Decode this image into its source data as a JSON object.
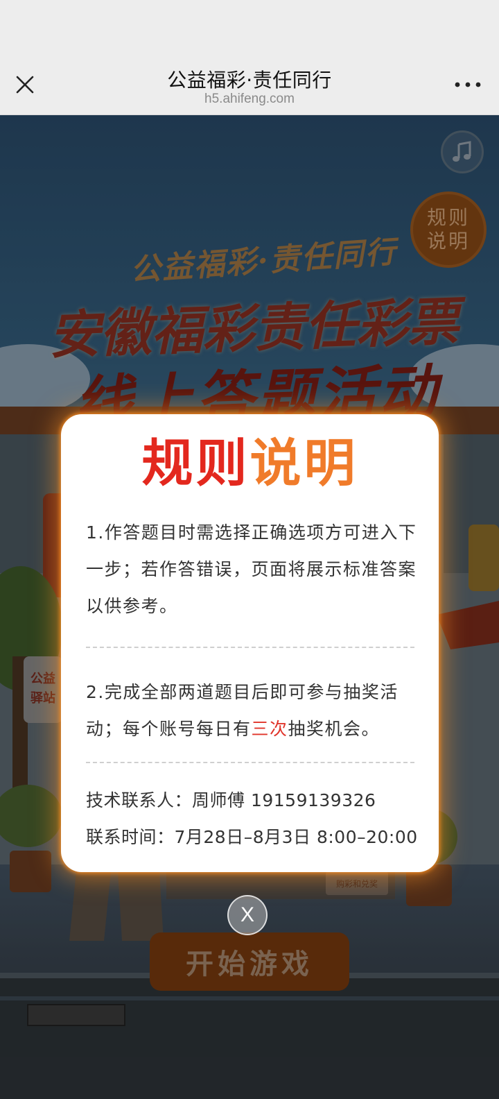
{
  "header": {
    "title": "公益福彩·责任同行",
    "url": "h5.ahifeng.com"
  },
  "game": {
    "rules_button": "规则\n说明",
    "title_small": "公益福彩·责任同行",
    "title_big_line1": "安徽福彩责任彩票",
    "title_big_line2": "线上答题活动",
    "start_button": "开始游戏",
    "sign_left": "公益\n驿站",
    "sign_shop": "购彩和兑奖"
  },
  "modal": {
    "title_part1": "规则",
    "title_part2": "说明",
    "rule1": "1.作答题目时需选择正确选项方可进入下一步；若作答错误，页面将展示标准答案以供参考。",
    "rule2_before": "2.完成全部两道题目后即可参与抽奖活动；每个账号每日有",
    "rule2_highlight": "三次",
    "rule2_after": "抽奖机会。",
    "contact_line1": "技术联系人：周师傅 19159139326",
    "contact_line2": "联系时间：7月28日–8月3日 8:00–20:00",
    "close_label": "X"
  },
  "colors": {
    "title_red": "#e3281e",
    "title_orange": "#f07b2a",
    "highlight": "#e0342a",
    "modal_glow": "#ff9628"
  },
  "icons": [
    "close-icon",
    "more-icon",
    "music-icon"
  ]
}
